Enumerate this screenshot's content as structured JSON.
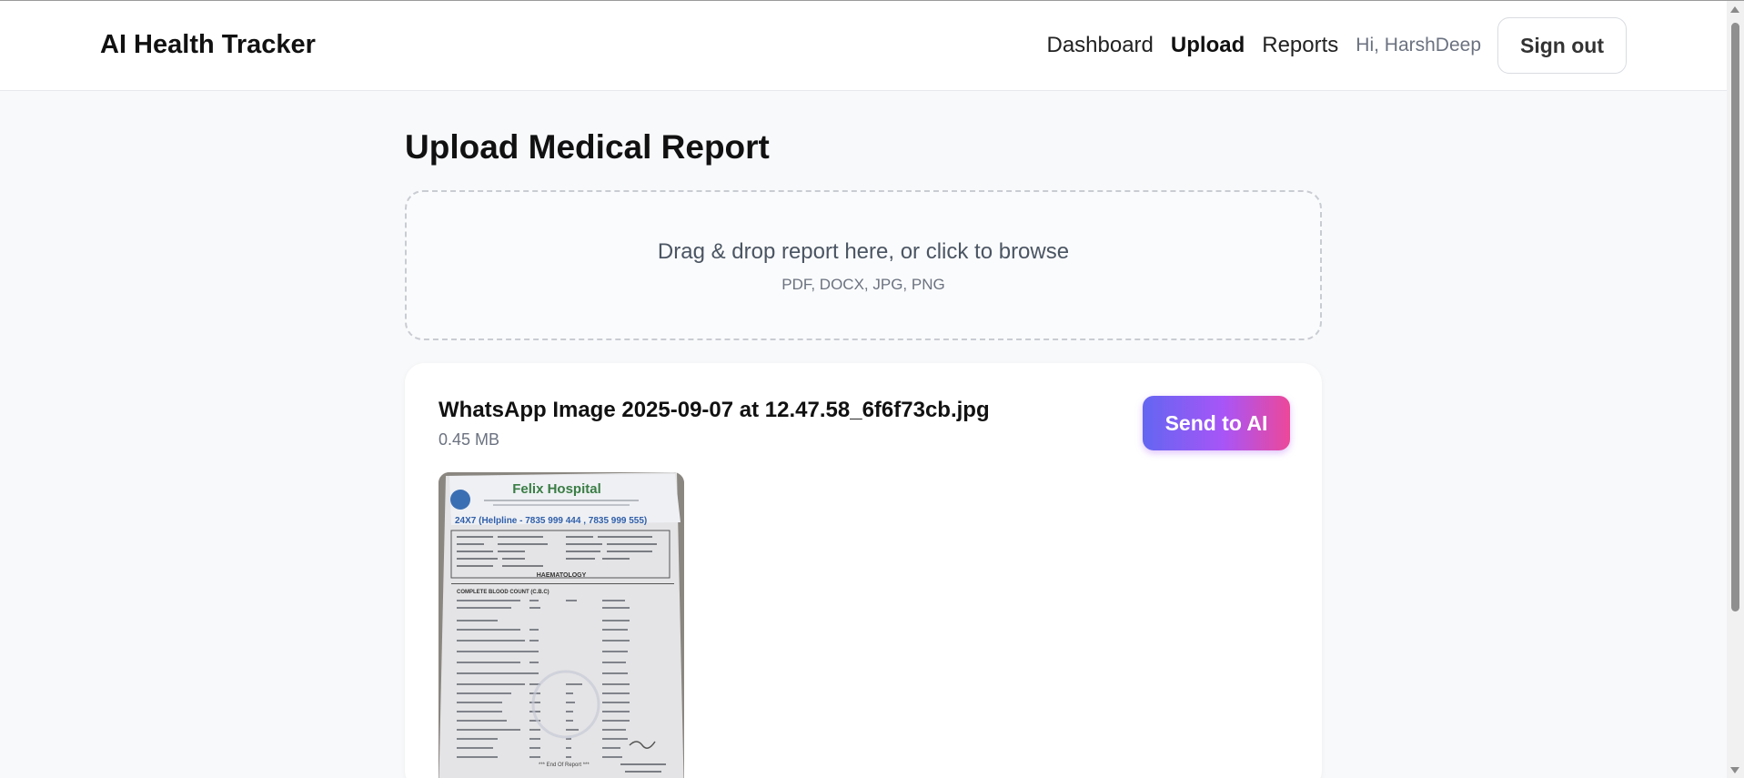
{
  "header": {
    "brand": "AI Health Tracker",
    "nav": {
      "dashboard": "Dashboard",
      "upload": "Upload",
      "reports": "Reports"
    },
    "greeting": "Hi, HarshDeep",
    "sign_out": "Sign out"
  },
  "page": {
    "title": "Upload Medical Report"
  },
  "dropzone": {
    "text": "Drag & drop report here, or click to browse",
    "formats": "PDF, DOCX, JPG, PNG"
  },
  "file": {
    "name": "WhatsApp Image 2025-09-07 at 12.47.58_6f6f73cb.jpg",
    "size": "0.45 MB",
    "send_label": "Send to AI"
  },
  "report_preview": {
    "hospital": "Felix Hospital",
    "helpline": "24X7 (Helpline - 7835 999 444 , 7835 999 555)",
    "section": "HAEMATOLOGY",
    "test": "COMPLETE BLOOD COUNT (C.B.C)",
    "footer": "*** End Of Report ***"
  },
  "colors": {
    "accent_start": "#6366f1",
    "accent_mid": "#a855f7",
    "accent_end": "#ec4899",
    "page_bg": "#f8f9fb"
  }
}
